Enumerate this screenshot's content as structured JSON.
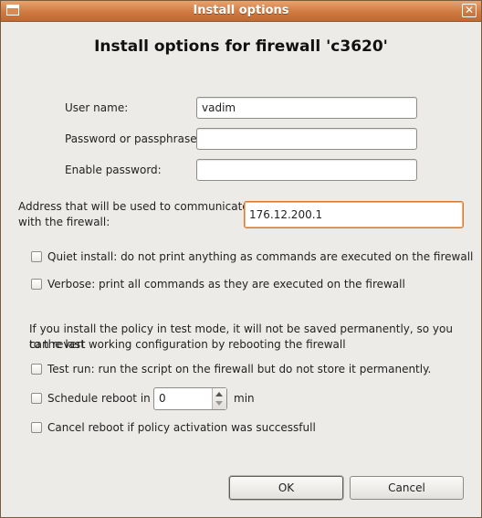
{
  "window": {
    "title": "Install options",
    "close_glyph": "✕"
  },
  "heading": "Install options for firewall 'c3620'",
  "credentials": {
    "username_label": "User name:",
    "username_value": "vadim",
    "password_label": "Password or passphrase:",
    "password_value": "",
    "enable_password_label": "Enable password:",
    "enable_password_value": ""
  },
  "address": {
    "label_line1": "Address that will be used to communicate",
    "label_line2": "with the firewall:",
    "value": "176.12.200.1"
  },
  "options": {
    "quiet_install": "Quiet install: do not print anything as commands are executed on the firewall",
    "verbose": "Verbose: print all commands as they are executed on the firewall"
  },
  "test_mode": {
    "info_line1": "If you install the policy in test mode, it will not be saved permanently, so you can revert",
    "info_line2": "to the last working configuration by rebooting the firewall",
    "test_run": "Test run: run the script on the firewall but do not store it permanently.",
    "schedule_reboot": "Schedule reboot in",
    "schedule_value": "0",
    "schedule_unit": "min",
    "cancel_reboot": "Cancel reboot if policy activation was successfull"
  },
  "buttons": {
    "ok": "OK",
    "cancel": "Cancel"
  },
  "colors": {
    "titlebar": "#cf7a41",
    "focus_border": "#d27a2e",
    "dialog_bg": "#edebe8"
  }
}
